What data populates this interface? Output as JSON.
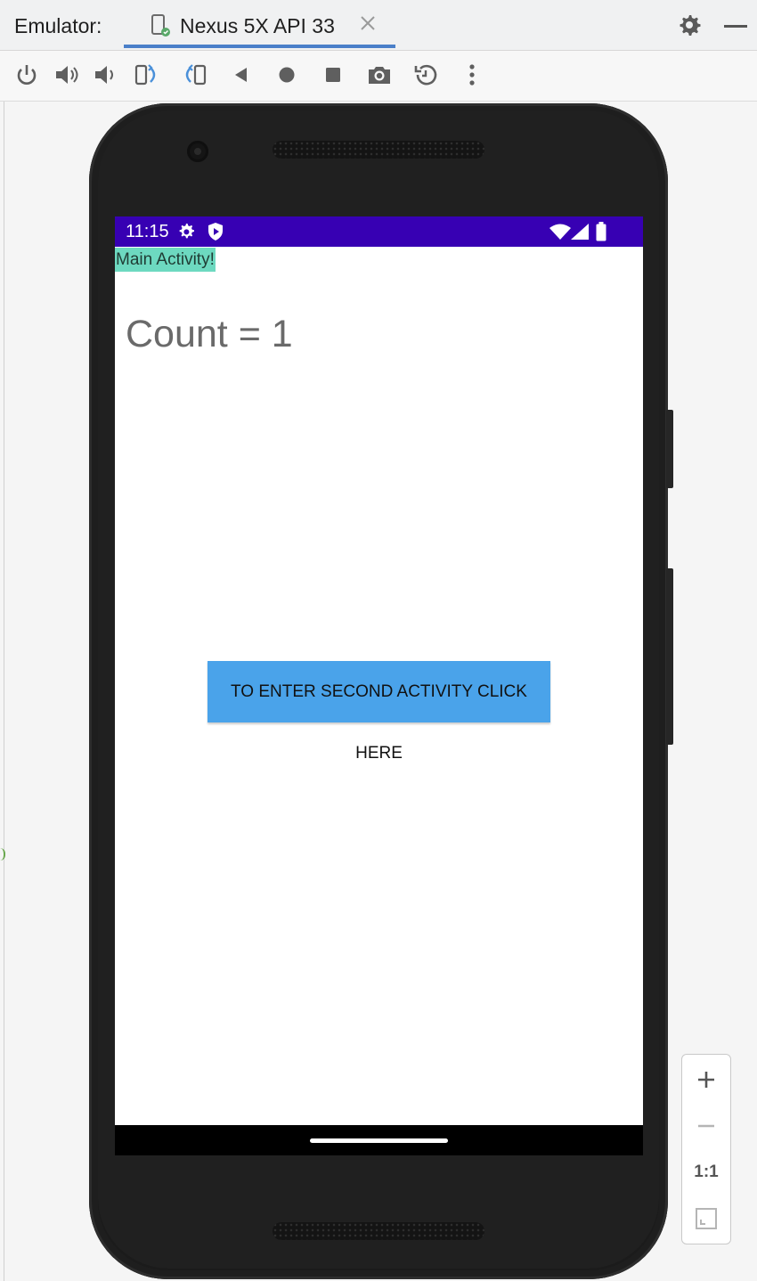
{
  "header": {
    "label": "Emulator:",
    "tab_title": "Nexus 5X API 33"
  },
  "phone": {
    "status_bar": {
      "time": "11:15"
    },
    "app": {
      "activity_label": "Main Activity!",
      "count_text": "Count = 1",
      "button_label": "TO ENTER SECOND ACTIVITY CLICK HERE"
    }
  },
  "zoom": {
    "actual_size_label": "1:1"
  },
  "colors": {
    "status_bar": "#3700b3",
    "label_bg": "#6dd9c0",
    "button_bg": "#4aa3ea",
    "tab_underline": "#4a7fc9"
  }
}
